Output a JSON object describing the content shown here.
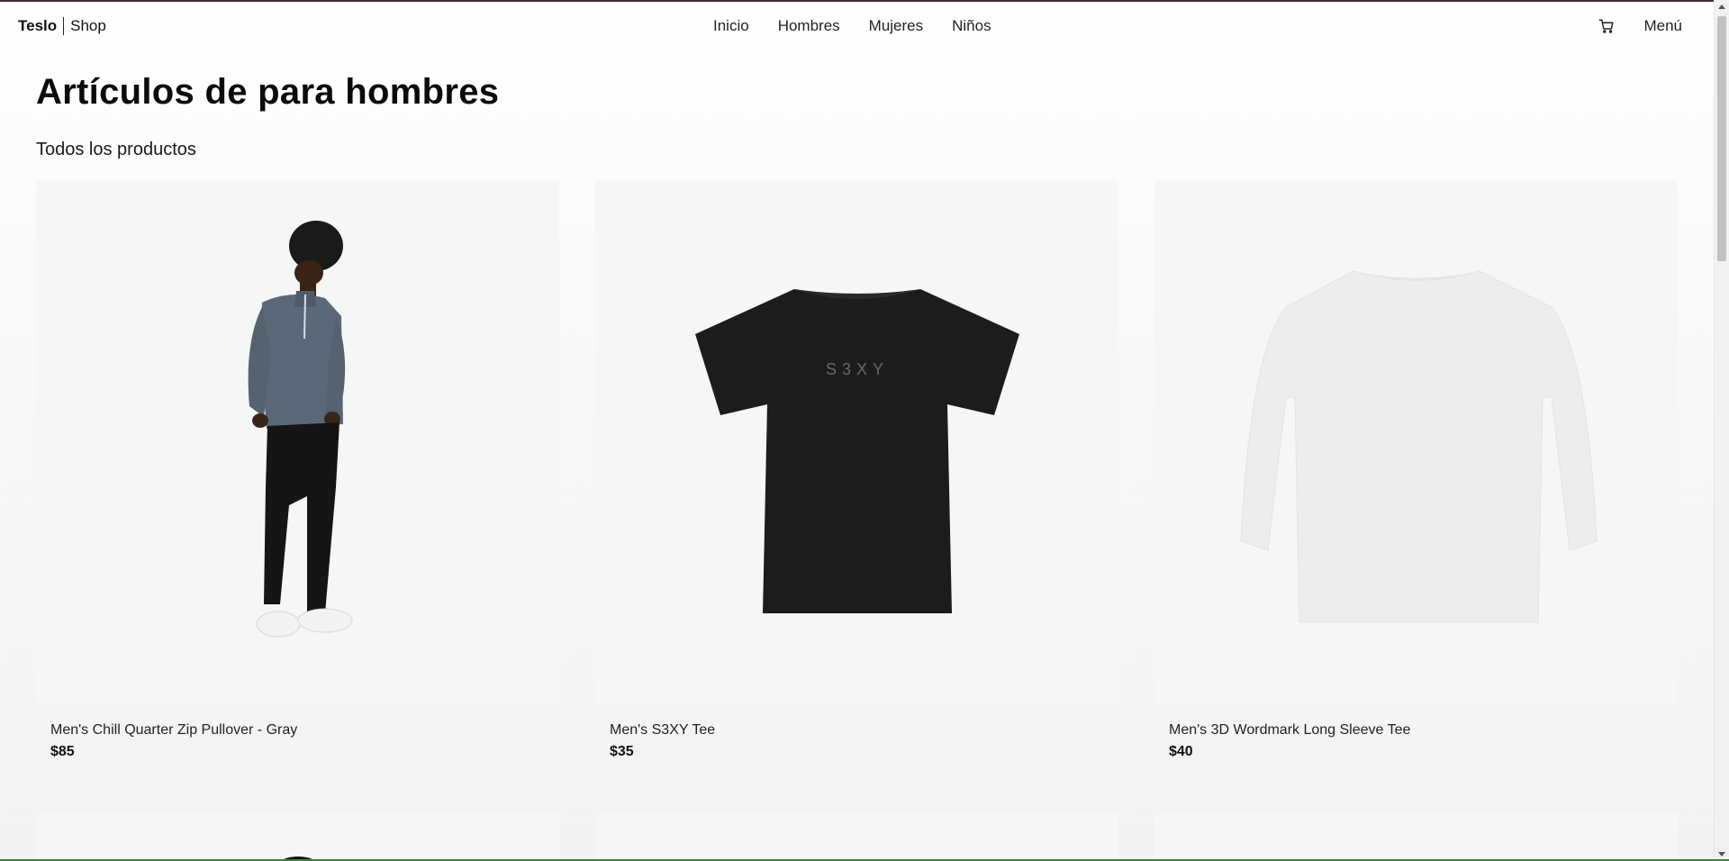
{
  "navbar": {
    "brand": "Teslo",
    "shop": "Shop",
    "links": [
      "Inicio",
      "Hombres",
      "Mujeres",
      "Niños"
    ],
    "cart_icon": "cart-icon",
    "menu_label": "Menú"
  },
  "page": {
    "title": "Artículos de para hombres",
    "subtitle": "Todos los productos"
  },
  "products": [
    {
      "name": "Men's Chill Quarter Zip Pullover - Gray",
      "price": "$85"
    },
    {
      "name": "Men's S3XY Tee",
      "price": "$35",
      "print": "S3XY"
    },
    {
      "name": "Men's 3D Wordmark Long Sleeve Tee",
      "price": "$40"
    }
  ],
  "colors": {
    "pullover": "#5a6878",
    "black_tee": "#1c1c1c",
    "white_tee": "#ededed"
  }
}
